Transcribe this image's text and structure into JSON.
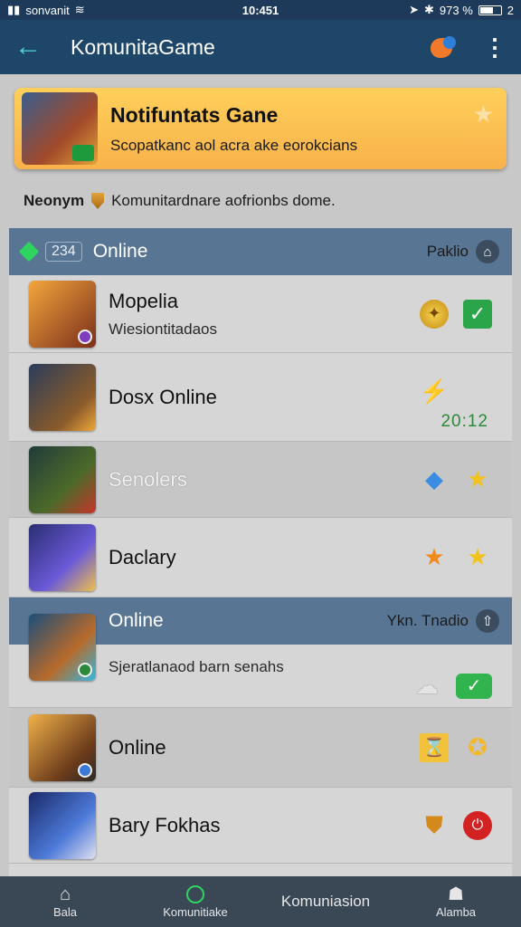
{
  "status_bar": {
    "carrier": "sonvanit",
    "time": "10:451",
    "battery": "973 %",
    "extra": "2"
  },
  "app_bar": {
    "title": "KomunitaGame"
  },
  "notification": {
    "title": "Notifuntats Gane",
    "subtitle": "Scopatkanc aol acra ake eorokcians"
  },
  "info_line": {
    "name": "Neonym",
    "text": "Komunitardnare aofrionbs dome."
  },
  "section1": {
    "count": "234",
    "title": "Online",
    "right_label": "Paklio"
  },
  "rows1": [
    {
      "title": "Mopelia",
      "subtitle": "Wiesiontitadaos"
    },
    {
      "title": "Dosx Online",
      "timer": "20:12"
    },
    {
      "title": "Senolers"
    },
    {
      "title": "Daclary"
    }
  ],
  "section2": {
    "title": "Online",
    "right_label": "Ykn. Tnadio",
    "subtitle": "Sjeratlanaod barn senahs"
  },
  "rows2": [
    {
      "title": "Online"
    },
    {
      "title": "Bary Fokhas"
    }
  ],
  "bottom_nav": [
    {
      "label": "Bala"
    },
    {
      "label": "Komunitiake"
    },
    {
      "label": "Komuniasion"
    },
    {
      "label": "Alamba"
    }
  ],
  "colors": {
    "app_bar": "#1e4669",
    "section_header": "#587594",
    "accent_green": "#2fd460",
    "notification": "#f8b24a"
  }
}
